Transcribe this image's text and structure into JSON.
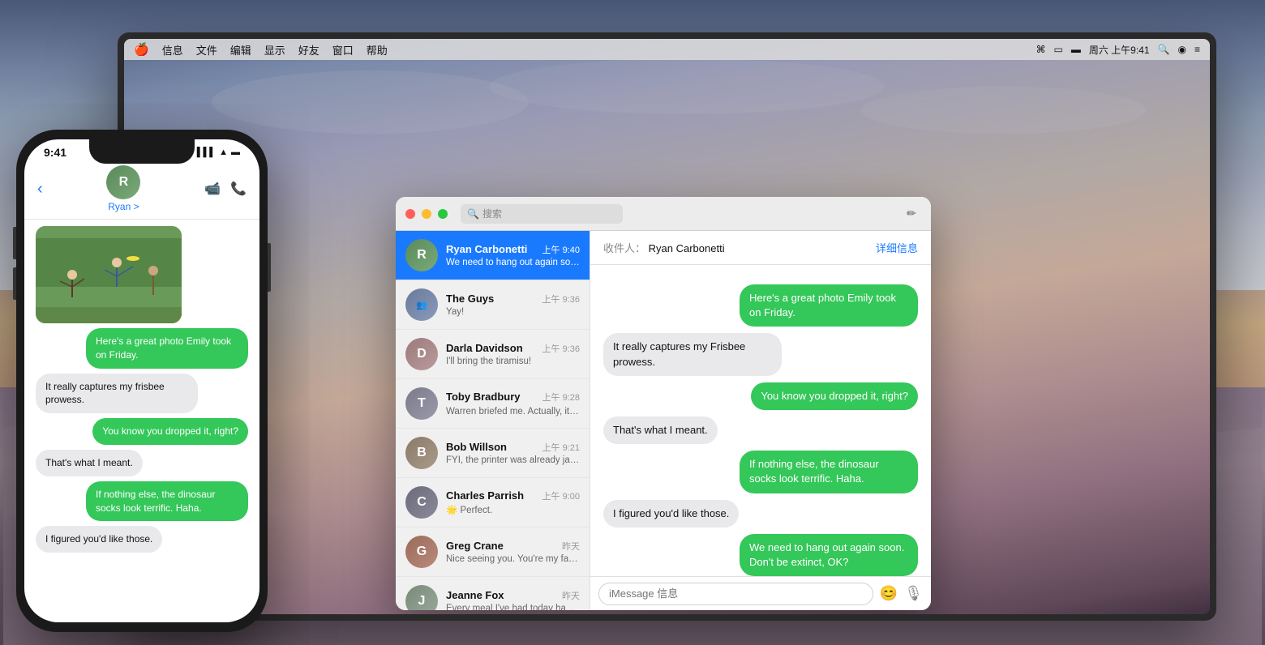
{
  "bg": {
    "description": "macOS Catalina landscape wallpaper with mountains and water"
  },
  "menubar": {
    "apple": "🍎",
    "items": [
      "信息",
      "文件",
      "编辑",
      "显示",
      "好友",
      "窗口",
      "帮助"
    ],
    "right": {
      "wifi": "WiFi",
      "airplay": "AirPlay",
      "battery": "Battery",
      "datetime": "周六 上午9:41",
      "search": "Search",
      "siri": "Siri",
      "menu": "Menu"
    }
  },
  "messages_window": {
    "search_placeholder": "搜索",
    "compose_icon": "✏",
    "recipient_label": "收件人：",
    "recipient_name": "Ryan Carbonetti",
    "details_btn": "详细信息",
    "conversations": [
      {
        "id": "ryan",
        "name": "Ryan Carbonetti",
        "time": "上午 9:40",
        "preview": "We need to hang out again soon. Don't be extinct, OK?",
        "active": true
      },
      {
        "id": "guys",
        "name": "The Guys",
        "time": "上午 9:36",
        "preview": "Yay!",
        "active": false
      },
      {
        "id": "darla",
        "name": "Darla Davidson",
        "time": "上午 9:36",
        "preview": "I'll bring the tiramisu!",
        "active": false
      },
      {
        "id": "toby",
        "name": "Toby Bradbury",
        "time": "上午 9:28",
        "preview": "Warren briefed me. Actually, it wasn't that brief. 🌊",
        "active": false
      },
      {
        "id": "bob",
        "name": "Bob Willson",
        "time": "上午 9:21",
        "preview": "FYI, the printer was already jammed when I got there.",
        "active": false
      },
      {
        "id": "charles",
        "name": "Charles Parrish",
        "time": "上午 9:00",
        "preview": "🌟 Perfect.",
        "active": false
      },
      {
        "id": "greg",
        "name": "Greg Crane",
        "time": "昨天",
        "preview": "Nice seeing you. You're my favorite person to randomly...",
        "active": false
      },
      {
        "id": "jeanne",
        "name": "Jeanne Fox",
        "time": "昨天",
        "preview": "Every meal I've had today has included bacon. #winning",
        "active": false
      }
    ],
    "messages": [
      {
        "type": "photo",
        "sender": "self"
      },
      {
        "type": "text",
        "sender": "self",
        "text": "Here's a great photo Emily took on Friday."
      },
      {
        "type": "text",
        "sender": "other",
        "text": "It really captures my Frisbee prowess."
      },
      {
        "type": "text",
        "sender": "self",
        "text": "You know you dropped it, right?"
      },
      {
        "type": "text",
        "sender": "other",
        "text": "That's what I meant."
      },
      {
        "type": "text",
        "sender": "self",
        "text": "If nothing else, the dinosaur socks look terrific. Haha."
      },
      {
        "type": "text",
        "sender": "other",
        "text": "I figured you'd like those."
      },
      {
        "type": "text",
        "sender": "self",
        "text": "We need to hang out again soon. Don't be extinct, OK?"
      }
    ],
    "input_placeholder": "iMessage 信息"
  },
  "iphone": {
    "time": "9:41",
    "contact_name": "Ryan >",
    "messages": [
      {
        "type": "photo",
        "sender": "received"
      },
      {
        "type": "text",
        "sender": "sent",
        "text": "Here's a great photo Emily took on Friday."
      },
      {
        "type": "text",
        "sender": "received",
        "text": "It really captures my frisbee prowess."
      },
      {
        "type": "text",
        "sender": "sent",
        "text": "You know you dropped it, right?"
      },
      {
        "type": "text",
        "sender": "received",
        "text": "That's what I meant."
      },
      {
        "type": "text",
        "sender": "sent",
        "text": "If nothing else, the dinosaur socks look terrific. Haha."
      },
      {
        "type": "text",
        "sender": "received",
        "text": "I figured you'd like those."
      }
    ]
  }
}
